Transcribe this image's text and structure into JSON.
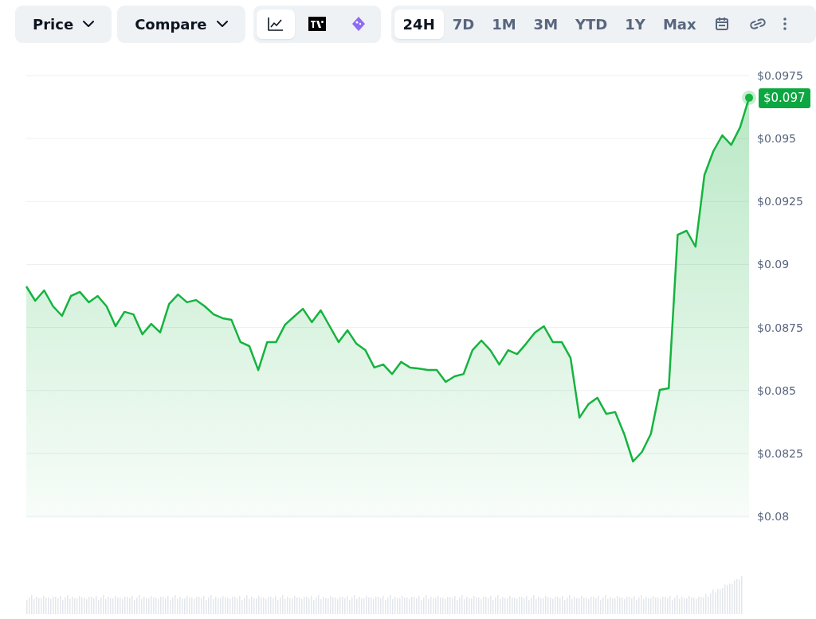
{
  "toolbar": {
    "dropdowns": [
      {
        "label": "Price"
      },
      {
        "label": "Compare"
      }
    ],
    "chart_types": [
      {
        "kind": "line",
        "selected": true
      },
      {
        "kind": "candles",
        "selected": false
      },
      {
        "kind": "ai",
        "selected": false
      }
    ],
    "ranges": [
      {
        "label": "24H",
        "selected": true
      },
      {
        "label": "7D",
        "selected": false
      },
      {
        "label": "1M",
        "selected": false
      },
      {
        "label": "3M",
        "selected": false
      },
      {
        "label": "YTD",
        "selected": false
      },
      {
        "label": "1Y",
        "selected": false
      },
      {
        "label": "Max",
        "selected": false
      }
    ]
  },
  "chart": {
    "current_price": "$0.097",
    "chart_data": {
      "type": "area",
      "grid": true,
      "ylim": [
        0.08,
        0.0975
      ],
      "yticks": [
        {
          "value": 0.08,
          "label": "$0.08"
        },
        {
          "value": 0.0825,
          "label": "$0.0825"
        },
        {
          "value": 0.085,
          "label": "$0.085"
        },
        {
          "value": 0.0875,
          "label": "$0.0875"
        },
        {
          "value": 0.09,
          "label": "$0.09"
        },
        {
          "value": 0.0925,
          "label": "$0.0925"
        },
        {
          "value": 0.095,
          "label": "$0.095"
        },
        {
          "value": 0.0975,
          "label": "$0.0975"
        }
      ],
      "series": [
        {
          "color": "#16b33f",
          "values": [
            0.08913,
            0.08856,
            0.08897,
            0.08834,
            0.08796,
            0.08875,
            0.08891,
            0.0885,
            0.08875,
            0.08834,
            0.08755,
            0.08812,
            0.08802,
            0.08723,
            0.08764,
            0.0873,
            0.08843,
            0.08881,
            0.0885,
            0.08859,
            0.08834,
            0.08802,
            0.08787,
            0.0878,
            0.08692,
            0.08676,
            0.08581,
            0.08692,
            0.08692,
            0.08761,
            0.08793,
            0.08824,
            0.08771,
            0.08818,
            0.08755,
            0.08692,
            0.08739,
            0.08685,
            0.0866,
            0.08591,
            0.08603,
            0.08565,
            0.08613,
            0.08591,
            0.08587,
            0.08581,
            0.08581,
            0.08534,
            0.08556,
            0.08565,
            0.0866,
            0.08698,
            0.0866,
            0.08603,
            0.0866,
            0.08644,
            0.08685,
            0.0873,
            0.08755,
            0.08692,
            0.08692,
            0.08629,
            0.08392,
            0.08445,
            0.08471,
            0.08407,
            0.08414,
            0.08328,
            0.08218,
            0.08256,
            0.08328,
            0.08502,
            0.08509,
            0.09118,
            0.09134,
            0.09071,
            0.09355,
            0.0945,
            0.09513,
            0.09475,
            0.09545,
            0.09662
          ]
        }
      ]
    }
  }
}
